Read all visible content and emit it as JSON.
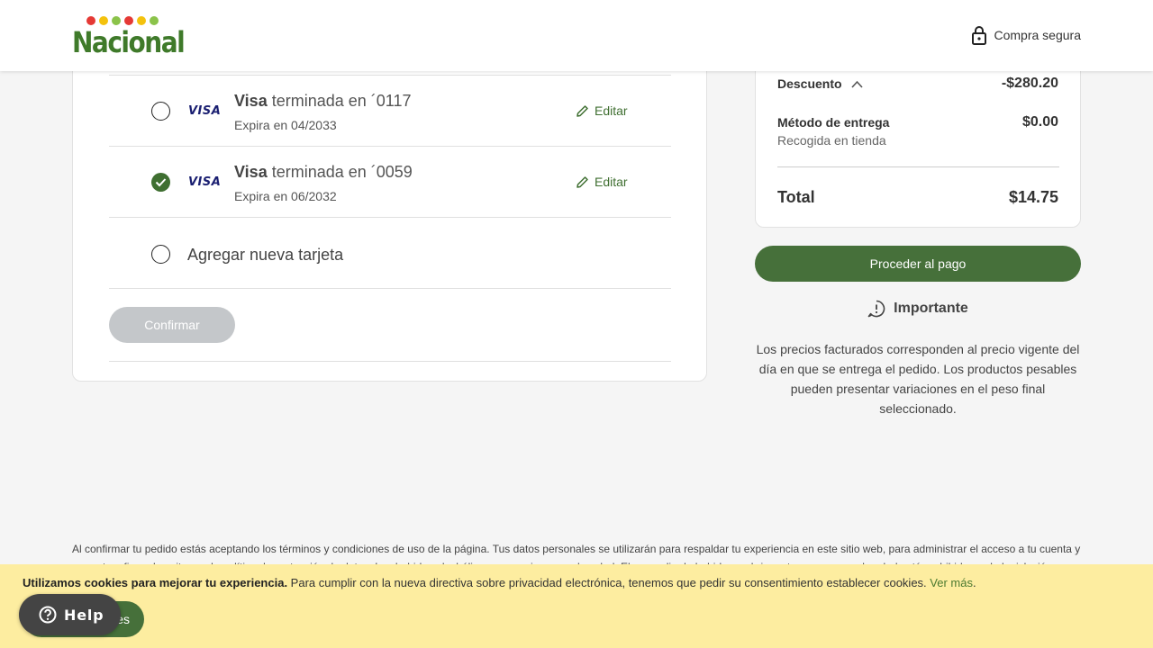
{
  "header": {
    "logo_text": "Nacional",
    "logo_dot_colors": [
      "#e53935",
      "#f4c20d",
      "#8bc34a",
      "#e53935",
      "#f4c20d",
      "#8bc34a"
    ],
    "secure_label": "Compra segura"
  },
  "payment": {
    "cards": [
      {
        "brand": "Visa",
        "title_suffix": "terminada en ´0117",
        "expiry": "Expira en 04/2033",
        "edit_label": "Editar",
        "selected": false
      },
      {
        "brand": "Visa",
        "title_suffix": "terminada en ´0059",
        "expiry": "Expira en 06/2032",
        "edit_label": "Editar",
        "selected": true
      }
    ],
    "visa_logo": "VISA",
    "add_card_label": "Agregar nueva tarjeta",
    "confirm_label": "Confirmar"
  },
  "summary": {
    "discount_label": "Descuento",
    "discount_value": "-$280.20",
    "delivery_label": "Método de entrega",
    "delivery_value": "$0.00",
    "delivery_sub": "Recogida en tienda",
    "total_label": "Total",
    "total_value": "$14.75",
    "proceed_label": "Proceder al pago",
    "important_title": "Importante",
    "important_text": "Los precios facturados corresponden al precio vigente del día en que se entrega el pedido. Los productos pesables pueden presentar variaciones en el peso final seleccionado."
  },
  "legal_text": "Al confirmar tu pedido estás aceptando los términos y condiciones de uso de la página. Tus datos personales se utilizarán para respaldar tu experiencia en este sitio web, para administrar el acceso a tu cuenta y para otros fines descritos en la política de protección de datos. Las bebidas alcohólicas son nocivas para la salud. El expendio de bebidas embriagantes a menores de edad está prohibido por la legislación.",
  "cookie": {
    "bold_text": "Utilizamos cookies para mejorar tu experiencia.",
    "text": " Para cumplir con la nueva directiva sobre privacidad electrónica, tenemos que pedir su consentimiento establecer cookies. ",
    "link": "Ver más",
    "link_suffix": ".",
    "button_label": "Aceptar cookies"
  },
  "help": {
    "label": "Help"
  },
  "colors": {
    "brand_green": "#46703a",
    "cookie_bg": "#fdeda0",
    "disabled_btn": "#c4c7ca"
  }
}
